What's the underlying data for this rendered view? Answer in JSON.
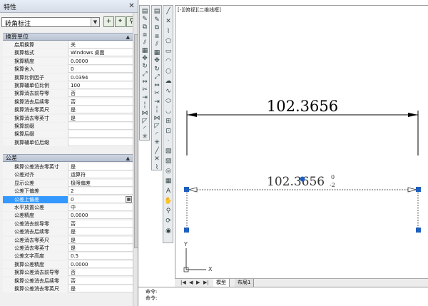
{
  "palette": {
    "title": "特性",
    "object_selector": "转角标注"
  },
  "sections": [
    {
      "title": "换算单位",
      "rows": [
        {
          "label": "启用换算",
          "value": "关"
        },
        {
          "label": "换算格式",
          "value": "Windows 桌面"
        },
        {
          "label": "换算精度",
          "value": "0.0000"
        },
        {
          "label": "换算舍入",
          "value": "0"
        },
        {
          "label": "换算比例因子",
          "value": "0.0394"
        },
        {
          "label": "换算辅单位比例",
          "value": "100"
        },
        {
          "label": "换算消去前导零",
          "value": "否"
        },
        {
          "label": "换算消去后续零",
          "value": "否"
        },
        {
          "label": "换算消去零英尺",
          "value": "是"
        },
        {
          "label": "换算消去零英寸",
          "value": "是"
        },
        {
          "label": "换算前缀",
          "value": ""
        },
        {
          "label": "换算后缀",
          "value": ""
        },
        {
          "label": "换算辅单位后缀",
          "value": ""
        }
      ]
    },
    {
      "title": "公差",
      "rows": [
        {
          "label": "换算公差消去零英寸",
          "value": "是"
        },
        {
          "label": "公差对齐",
          "value": "运算符"
        },
        {
          "label": "显示公差",
          "value": "极限偏差"
        },
        {
          "label": "公差下偏差",
          "value": "2"
        },
        {
          "label": "公差上偏差",
          "value": "0"
        },
        {
          "label": "水平放置公差",
          "value": "中"
        },
        {
          "label": "公差精度",
          "value": "0.0000"
        },
        {
          "label": "公差消去前导零",
          "value": "否"
        },
        {
          "label": "公差消去后续零",
          "value": "是"
        },
        {
          "label": "公差消去零英尺",
          "value": "是"
        },
        {
          "label": "公差消去零英寸",
          "value": "是"
        },
        {
          "label": "公差文字高度",
          "value": "0.5"
        },
        {
          "label": "换算公差精度",
          "value": "0.0000"
        },
        {
          "label": "换算公差消去前导零",
          "value": "否"
        },
        {
          "label": "换算公差消去后续零",
          "value": "否"
        },
        {
          "label": "换算公差消去零英尺",
          "value": "是"
        }
      ]
    }
  ],
  "viewport": {
    "label": "[-][俯视][二维线框]",
    "dimension_top": "102.3656",
    "dimension_bottom": "102.3656",
    "tolerance_upper": "0",
    "tolerance_lower": "-2",
    "axis_y": "Y",
    "axis_x": "X"
  },
  "layout_tabs": {
    "model": "模型",
    "layout1": "布局1"
  },
  "command": {
    "line1": "命令:",
    "line2": "命令:"
  },
  "toolbar_left_icons": [
    "layer-icon",
    "match-prop-icon",
    "copy-icon",
    "mirror-icon",
    "offset-icon",
    "array-icon",
    "move-icon",
    "rotate-icon",
    "scale-icon",
    "stretch-icon",
    "trim-icon",
    "extend-icon",
    "break-icon",
    "join-icon",
    "chamfer-icon",
    "fillet-icon",
    "explode-icon"
  ],
  "toolbar_right_icons": [
    "line-icon",
    "xline-icon",
    "polyline-icon",
    "polygon-icon",
    "rectangle-icon",
    "arc-icon",
    "circle-icon",
    "revcloud-icon",
    "spline-icon",
    "ellipse-icon",
    "ellipse-arc-icon",
    "insert-block-icon",
    "make-block-icon",
    "point-icon",
    "hatch-icon",
    "gradient-icon",
    "region-icon",
    "table-icon",
    "mtext-icon",
    "pan-icon",
    "zoom-icon",
    "orbit-icon",
    "steering-wheel-icon"
  ]
}
